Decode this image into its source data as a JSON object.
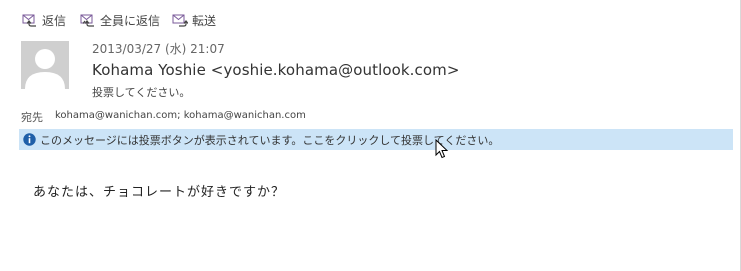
{
  "toolbar": {
    "reply_label": "返信",
    "reply_all_label": "全員に返信",
    "forward_label": "転送"
  },
  "message": {
    "date": "2013/03/27 (水) 21:07",
    "sender": "Kohama Yoshie <yoshie.kohama@outlook.com>",
    "subject": "投票してください。",
    "to_label": "宛先",
    "to_value": "kohama@wanichan.com; kohama@wanichan.com",
    "infobar_text": "このメッセージには投票ボタンが表示されています。ここをクリックして投票してください。",
    "body": "あなたは、チョコレートが好きですか？"
  },
  "colors": {
    "infobar_bg": "#cce4f7",
    "icon_purple": "#8a5aa8",
    "info_icon": "#1f5fa8"
  }
}
